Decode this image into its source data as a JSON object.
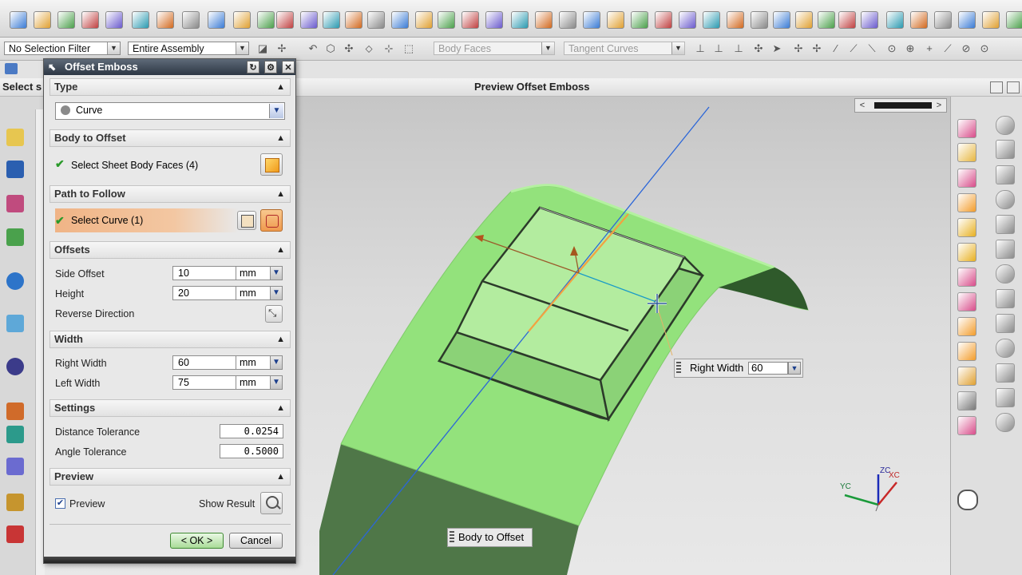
{
  "toolbar": {
    "selection_filter": "No Selection Filter",
    "scope": "Entire Assembly",
    "face_rule": "Body Faces",
    "curve_rule": "Tangent Curves"
  },
  "cue_line": {
    "left_text": "Select s",
    "prompt": "Preview Offset Emboss"
  },
  "dialog": {
    "title": "Offset Emboss",
    "sections": {
      "type": {
        "header": "Type",
        "value": "Curve"
      },
      "body": {
        "header": "Body to Offset",
        "select_label": "Select Sheet Body Faces (4)"
      },
      "path": {
        "header": "Path to Follow",
        "select_label": "Select Curve (1)"
      },
      "offsets": {
        "header": "Offsets",
        "side_offset_label": "Side Offset",
        "side_offset_value": "10",
        "height_label": "Height",
        "height_value": "20",
        "reverse_label": "Reverse Direction",
        "unit": "mm"
      },
      "width": {
        "header": "Width",
        "right_label": "Right Width",
        "right_value": "60",
        "left_label": "Left Width",
        "left_value": "75",
        "unit": "mm"
      },
      "settings": {
        "header": "Settings",
        "dist_tol_label": "Distance Tolerance",
        "dist_tol_value": "0.0254",
        "angle_tol_label": "Angle Tolerance",
        "angle_tol_value": "0.5000"
      },
      "preview": {
        "header": "Preview",
        "checkbox_label": "Preview",
        "show_result_label": "Show Result"
      }
    },
    "ok_label": "< OK >",
    "cancel_label": "Cancel"
  },
  "viewport": {
    "right_width_tag": "Right Width",
    "right_width_value": "60",
    "body_tag": "Body to Offset",
    "triad": {
      "zc": "ZC",
      "yc": "YC",
      "xc": "XC"
    }
  },
  "colors": {
    "sheet_body": "#8fdf78",
    "sheet_body_dark": "#3d6a36",
    "selected_path": "#f2a240",
    "dialog_title": "#2d3744"
  }
}
